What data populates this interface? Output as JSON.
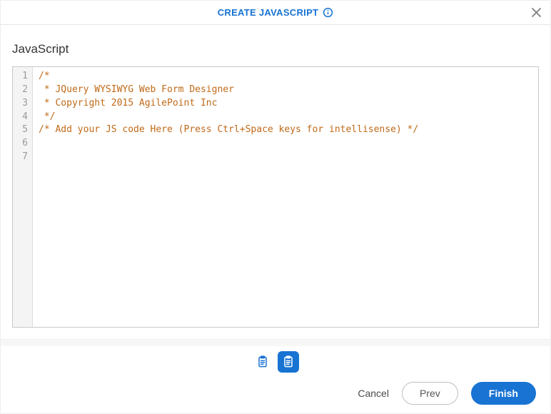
{
  "header": {
    "title": "CREATE JAVASCRIPT"
  },
  "section": {
    "title": "JavaScript"
  },
  "editor": {
    "line_numbers": [
      "1",
      "2",
      "3",
      "4",
      "5",
      "6",
      "7"
    ],
    "lines": [
      "/*",
      " * JQuery WYSIWYG Web Form Designer",
      " * Copyright 2015 AgilePoint Inc",
      " */",
      "",
      "/* Add your JS code Here (Press Ctrl+Space keys for intellisense) */",
      ""
    ]
  },
  "pager": {
    "step1_icon": "clipboard-list-icon",
    "step2_icon": "clipboard-code-icon"
  },
  "actions": {
    "cancel": "Cancel",
    "prev": "Prev",
    "finish": "Finish"
  }
}
